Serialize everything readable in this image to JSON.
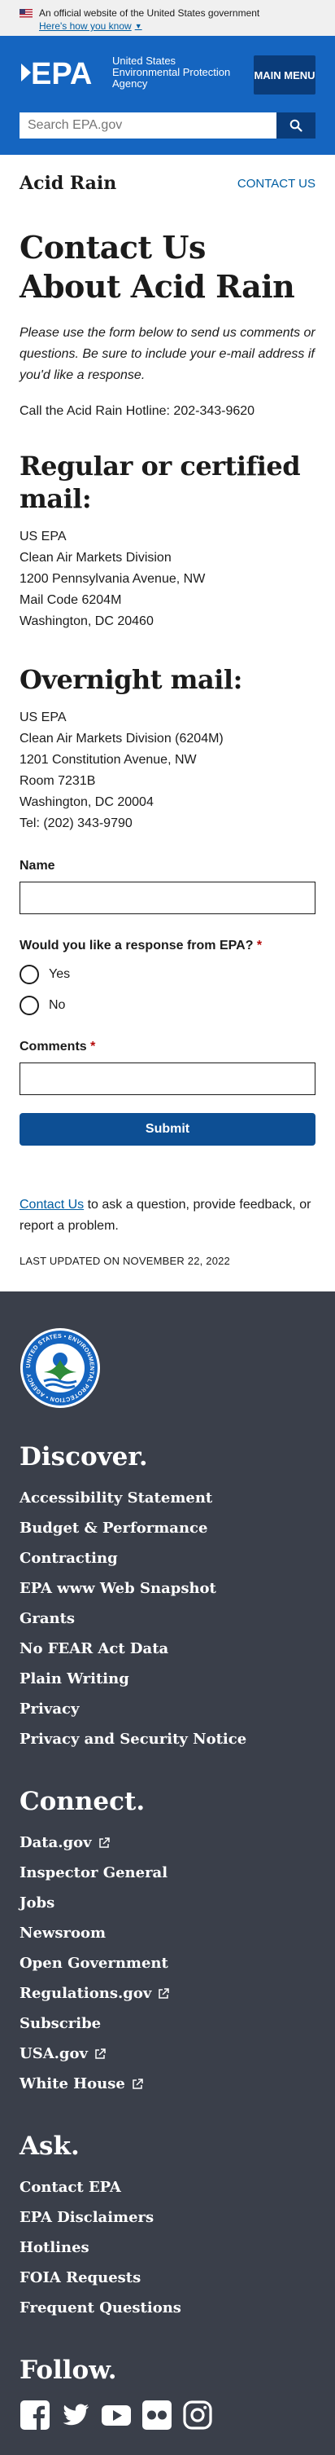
{
  "gov_banner": {
    "official_text": "An official website of the United States government",
    "how_text": "Here's how you know"
  },
  "header": {
    "logo_text": "EPA",
    "agency_name": "United States Environmental Protection Agency",
    "menu_label": "MAIN MENU",
    "search_placeholder": "Search EPA.gov"
  },
  "topic": {
    "title": "Acid Rain",
    "contact_label": "CONTACT US"
  },
  "page": {
    "title": "Contact Us About Acid Rain",
    "intro": "Please use the form below to send us comments or questions. Be sure to include your e-mail address if you'd like a response.",
    "hotline": "Call the Acid Rain Hotline: 202-343-9620"
  },
  "regular_mail": {
    "heading": "Regular or certified mail:",
    "lines": [
      "US EPA",
      "Clean Air Markets Division",
      "1200 Pennsylvania Avenue, NW",
      "Mail Code 6204M",
      "Washington, DC 20460"
    ]
  },
  "overnight_mail": {
    "heading": "Overnight mail:",
    "lines": [
      "US EPA",
      "Clean Air Markets Division (6204M)",
      "1201 Constitution Avenue, NW",
      "Room 7231B",
      "Washington, DC 20004",
      "Tel: (202) 343-9790"
    ]
  },
  "form": {
    "name_label": "Name",
    "response_label": "Would you like a response from EPA?",
    "required_mark": "*",
    "yes_label": "Yes",
    "no_label": "No",
    "comments_label": "Comments",
    "submit_label": "Submit"
  },
  "contact_block": {
    "link_text": "Contact Us",
    "rest_text": " to ask a question, provide feedback, or report a problem.",
    "last_updated": "LAST UPDATED ON NOVEMBER 22, 2022"
  },
  "footer": {
    "seal_text": "UNITED STATES • ENVIRONMENTAL PROTECTION • AGENCY",
    "discover": {
      "heading": "Discover.",
      "items": [
        "Accessibility Statement",
        "Budget & Performance",
        "Contracting",
        "EPA www Web Snapshot",
        "Grants",
        "No FEAR Act Data",
        "Plain Writing",
        "Privacy",
        "Privacy and Security Notice"
      ]
    },
    "connect": {
      "heading": "Connect.",
      "items": [
        "Data.gov",
        "Inspector General",
        "Jobs",
        "Newsroom",
        "Open Government",
        "Regulations.gov",
        "Subscribe",
        "USA.gov",
        "White House"
      ]
    },
    "ask": {
      "heading": "Ask.",
      "items": [
        "Contact EPA",
        "EPA Disclaimers",
        "Hotlines",
        "FOIA Requests",
        "Frequent Questions"
      ]
    },
    "follow": {
      "heading": "Follow.",
      "icons": [
        "facebook-icon",
        "twitter-icon",
        "youtube-icon",
        "flickr-icon",
        "instagram-icon"
      ]
    }
  }
}
